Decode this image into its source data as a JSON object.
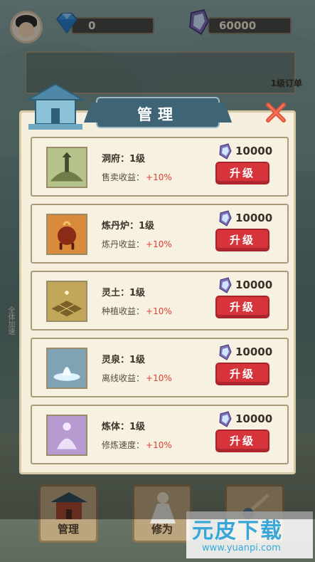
{
  "hud": {
    "gem_count": "0",
    "crystal_count": "60000",
    "order_label": "1级订单"
  },
  "side_tag": "全体加速",
  "bottom_nav": [
    {
      "label": "管理"
    },
    {
      "label": "修为"
    },
    {
      "label": ""
    }
  ],
  "watermark": {
    "title": "元皮下载",
    "url": "www.yuanpi.com"
  },
  "modal": {
    "title": "管理",
    "rows": [
      {
        "name": "洞府：1级",
        "bonus_label": "售卖收益：",
        "bonus_value": "+10%",
        "price": "10000",
        "button": "升级"
      },
      {
        "name": "炼丹炉：1级",
        "bonus_label": "炼丹收益：",
        "bonus_value": "+10%",
        "price": "10000",
        "button": "升级"
      },
      {
        "name": "灵土：1级",
        "bonus_label": "种植收益：",
        "bonus_value": "+10%",
        "price": "10000",
        "button": "升级"
      },
      {
        "name": "灵泉：1级",
        "bonus_label": "离线收益：",
        "bonus_value": "+10%",
        "price": "10000",
        "button": "升级"
      },
      {
        "name": "炼体：1级",
        "bonus_label": "修炼速度：",
        "bonus_value": "+10%",
        "price": "10000",
        "button": "升级"
      }
    ]
  },
  "colors": {
    "panel_bg": "#f6efde",
    "banner": "#3e6476",
    "upgrade_button": "#d6333b",
    "bonus_value": "#e23e34"
  }
}
